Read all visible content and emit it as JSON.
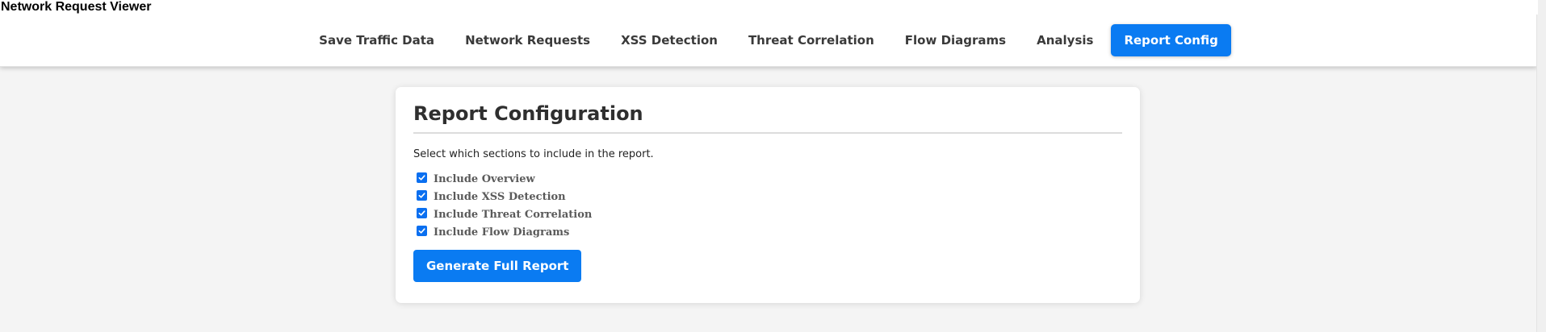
{
  "app": {
    "title": "Network Request Viewer"
  },
  "nav": {
    "tabs": [
      {
        "label": "Save Traffic Data"
      },
      {
        "label": "Network Requests"
      },
      {
        "label": "XSS Detection"
      },
      {
        "label": "Threat Correlation"
      },
      {
        "label": "Flow Diagrams"
      },
      {
        "label": "Analysis"
      },
      {
        "label": "Report Config"
      }
    ],
    "active_tab": "Report Config"
  },
  "report": {
    "title": "Report Configuration",
    "description": "Select which sections to include in the report.",
    "options": [
      {
        "label": "Include Overview",
        "checked": true
      },
      {
        "label": "Include XSS Detection",
        "checked": true
      },
      {
        "label": "Include Threat Correlation",
        "checked": true
      },
      {
        "label": "Include Flow Diagrams",
        "checked": true
      }
    ],
    "generate_label": "Generate Full Report"
  },
  "colors": {
    "accent": "#0a7bf2",
    "background": "#f4f4f4"
  }
}
